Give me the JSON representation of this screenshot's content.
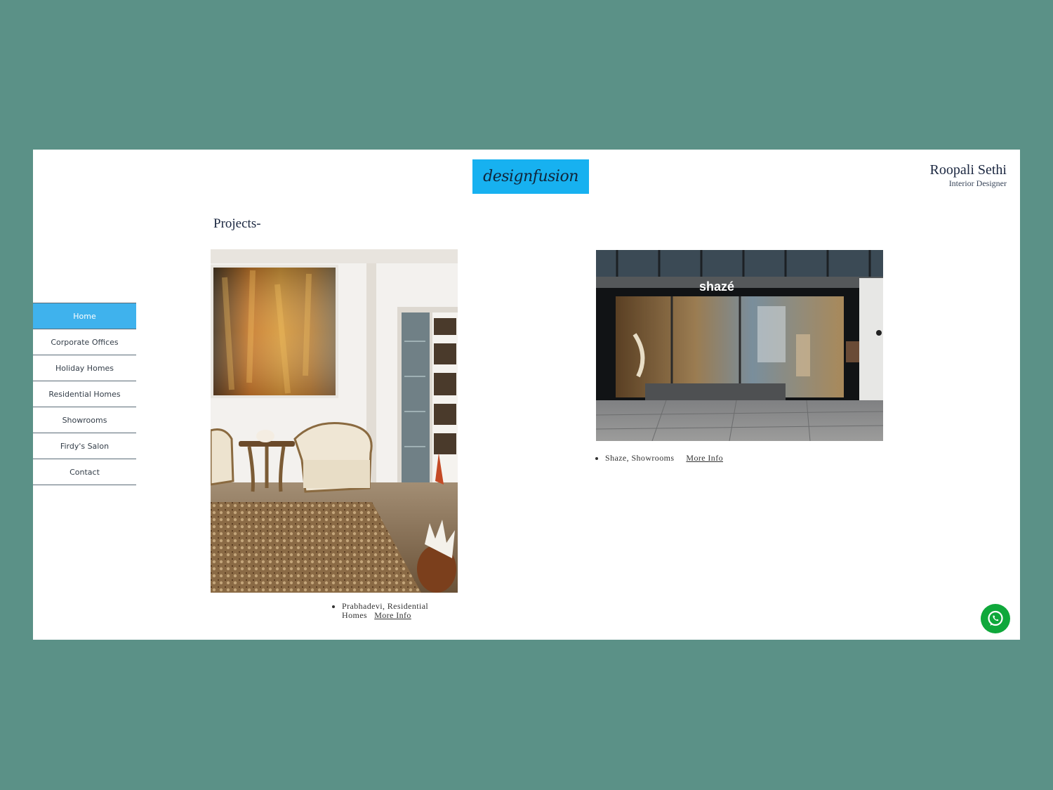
{
  "brand": {
    "logo_text": "designfusion",
    "logo_color": "#17b1f0"
  },
  "owner": {
    "name": "Roopali Sethi",
    "role": "Interior Designer"
  },
  "section": {
    "title": "Projects-"
  },
  "nav": {
    "items": [
      {
        "label": "Home",
        "active": true
      },
      {
        "label": "Corporate Offices"
      },
      {
        "label": "Holiday Homes"
      },
      {
        "label": "Residential Homes"
      },
      {
        "label": "Showrooms"
      },
      {
        "label": "Firdy's Salon"
      },
      {
        "label": "Contact"
      }
    ]
  },
  "projects": [
    {
      "caption": "Prabhadevi, Residential Homes",
      "link": "More Info"
    },
    {
      "caption": "Shaze, Showrooms",
      "link": "More Info",
      "sign_text": "shazé"
    }
  ],
  "colors": {
    "background": "#5b9187",
    "nav_active": "#3fb2ed",
    "whatsapp": "#0fa83b"
  },
  "icons": {
    "chat": "whatsapp-icon"
  }
}
